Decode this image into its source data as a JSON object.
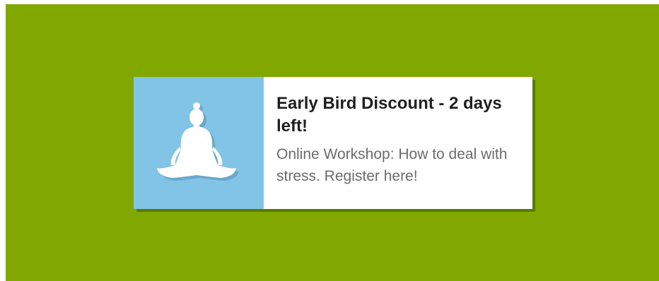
{
  "banner": {
    "title": "Early Bird Discount - 2 days left!",
    "subtitle": "Online Workshop: How to deal with stress. Register here!",
    "icon": "meditation-icon"
  },
  "colors": {
    "background": "#80a800",
    "icon_panel": "#82c4e6",
    "card": "#ffffff",
    "title_text": "#1f1f1f",
    "subtitle_text": "#6b6b6b"
  }
}
